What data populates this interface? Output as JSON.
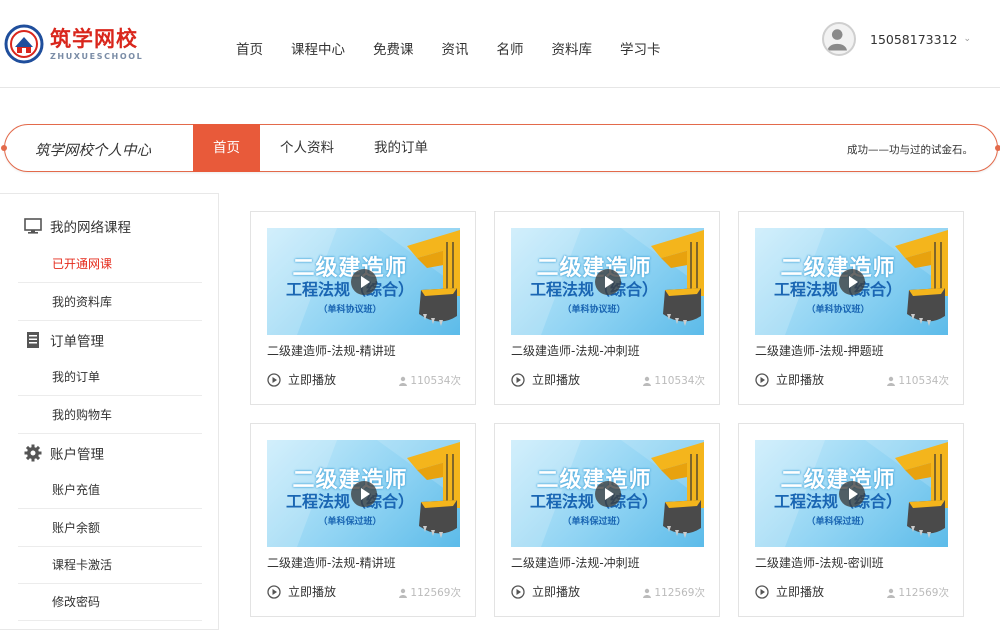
{
  "logo": {
    "name_cn": "筑学网校",
    "name_en": "ZHUXUESCHOOL"
  },
  "nav": [
    "首页",
    "课程中心",
    "免费课",
    "资讯",
    "名师",
    "资料库",
    "学习卡"
  ],
  "user": {
    "phone": "15058173312"
  },
  "center": {
    "title": "筑学网校个人中心",
    "tabs": [
      "首页",
      "个人资料",
      "我的订单"
    ],
    "active_tab": "首页",
    "motto": "成功——功与过的试金石。"
  },
  "sidebar": {
    "groups": [
      {
        "label": "我的网络课程",
        "icon": "monitor-icon",
        "items": [
          "已开通网课",
          "我的资料库"
        ]
      },
      {
        "label": "订单管理",
        "icon": "document-icon",
        "items": [
          "我的订单",
          "我的购物车"
        ]
      },
      {
        "label": "账户管理",
        "icon": "gear-icon",
        "items": [
          "账户充值",
          "账户余额",
          "课程卡激活",
          "修改密码"
        ]
      }
    ],
    "active_item": "已开通网课"
  },
  "course_common": {
    "thumb_heading": "二级建造师",
    "thumb_subject": "工程法规（综合）",
    "play_label": "立即播放"
  },
  "courses": [
    {
      "title": "二级建造师-法规-精讲班",
      "tag": "（单科协议班）",
      "views": "110534次"
    },
    {
      "title": "二级建造师-法规-冲刺班",
      "tag": "（单科协议班）",
      "views": "110534次"
    },
    {
      "title": "二级建造师-法规-押题班",
      "tag": "（单科协议班）",
      "views": "110534次"
    },
    {
      "title": "二级建造师-法规-精讲班",
      "tag": "（单科保过班）",
      "views": "112569次"
    },
    {
      "title": "二级建造师-法规-冲刺班",
      "tag": "（单科保过班）",
      "views": "112569次"
    },
    {
      "title": "二级建造师-法规-密训班",
      "tag": "（单科保过班）",
      "views": "112569次"
    }
  ],
  "colors": {
    "brand_red": "#d9261c",
    "accent_orange": "#e85a3a",
    "active_link": "#e52b1c"
  }
}
